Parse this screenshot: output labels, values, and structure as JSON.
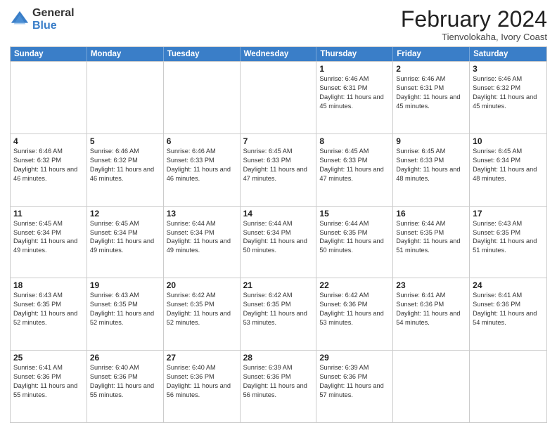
{
  "logo": {
    "general": "General",
    "blue": "Blue"
  },
  "title": "February 2024",
  "subtitle": "Tienvolokaha, Ivory Coast",
  "days": [
    "Sunday",
    "Monday",
    "Tuesday",
    "Wednesday",
    "Thursday",
    "Friday",
    "Saturday"
  ],
  "weeks": [
    [
      {
        "day": "",
        "info": ""
      },
      {
        "day": "",
        "info": ""
      },
      {
        "day": "",
        "info": ""
      },
      {
        "day": "",
        "info": ""
      },
      {
        "day": "1",
        "info": "Sunrise: 6:46 AM\nSunset: 6:31 PM\nDaylight: 11 hours and 45 minutes."
      },
      {
        "day": "2",
        "info": "Sunrise: 6:46 AM\nSunset: 6:31 PM\nDaylight: 11 hours and 45 minutes."
      },
      {
        "day": "3",
        "info": "Sunrise: 6:46 AM\nSunset: 6:32 PM\nDaylight: 11 hours and 45 minutes."
      }
    ],
    [
      {
        "day": "4",
        "info": "Sunrise: 6:46 AM\nSunset: 6:32 PM\nDaylight: 11 hours and 46 minutes."
      },
      {
        "day": "5",
        "info": "Sunrise: 6:46 AM\nSunset: 6:32 PM\nDaylight: 11 hours and 46 minutes."
      },
      {
        "day": "6",
        "info": "Sunrise: 6:46 AM\nSunset: 6:33 PM\nDaylight: 11 hours and 46 minutes."
      },
      {
        "day": "7",
        "info": "Sunrise: 6:45 AM\nSunset: 6:33 PM\nDaylight: 11 hours and 47 minutes."
      },
      {
        "day": "8",
        "info": "Sunrise: 6:45 AM\nSunset: 6:33 PM\nDaylight: 11 hours and 47 minutes."
      },
      {
        "day": "9",
        "info": "Sunrise: 6:45 AM\nSunset: 6:33 PM\nDaylight: 11 hours and 48 minutes."
      },
      {
        "day": "10",
        "info": "Sunrise: 6:45 AM\nSunset: 6:34 PM\nDaylight: 11 hours and 48 minutes."
      }
    ],
    [
      {
        "day": "11",
        "info": "Sunrise: 6:45 AM\nSunset: 6:34 PM\nDaylight: 11 hours and 49 minutes."
      },
      {
        "day": "12",
        "info": "Sunrise: 6:45 AM\nSunset: 6:34 PM\nDaylight: 11 hours and 49 minutes."
      },
      {
        "day": "13",
        "info": "Sunrise: 6:44 AM\nSunset: 6:34 PM\nDaylight: 11 hours and 49 minutes."
      },
      {
        "day": "14",
        "info": "Sunrise: 6:44 AM\nSunset: 6:34 PM\nDaylight: 11 hours and 50 minutes."
      },
      {
        "day": "15",
        "info": "Sunrise: 6:44 AM\nSunset: 6:35 PM\nDaylight: 11 hours and 50 minutes."
      },
      {
        "day": "16",
        "info": "Sunrise: 6:44 AM\nSunset: 6:35 PM\nDaylight: 11 hours and 51 minutes."
      },
      {
        "day": "17",
        "info": "Sunrise: 6:43 AM\nSunset: 6:35 PM\nDaylight: 11 hours and 51 minutes."
      }
    ],
    [
      {
        "day": "18",
        "info": "Sunrise: 6:43 AM\nSunset: 6:35 PM\nDaylight: 11 hours and 52 minutes."
      },
      {
        "day": "19",
        "info": "Sunrise: 6:43 AM\nSunset: 6:35 PM\nDaylight: 11 hours and 52 minutes."
      },
      {
        "day": "20",
        "info": "Sunrise: 6:42 AM\nSunset: 6:35 PM\nDaylight: 11 hours and 52 minutes."
      },
      {
        "day": "21",
        "info": "Sunrise: 6:42 AM\nSunset: 6:35 PM\nDaylight: 11 hours and 53 minutes."
      },
      {
        "day": "22",
        "info": "Sunrise: 6:42 AM\nSunset: 6:36 PM\nDaylight: 11 hours and 53 minutes."
      },
      {
        "day": "23",
        "info": "Sunrise: 6:41 AM\nSunset: 6:36 PM\nDaylight: 11 hours and 54 minutes."
      },
      {
        "day": "24",
        "info": "Sunrise: 6:41 AM\nSunset: 6:36 PM\nDaylight: 11 hours and 54 minutes."
      }
    ],
    [
      {
        "day": "25",
        "info": "Sunrise: 6:41 AM\nSunset: 6:36 PM\nDaylight: 11 hours and 55 minutes."
      },
      {
        "day": "26",
        "info": "Sunrise: 6:40 AM\nSunset: 6:36 PM\nDaylight: 11 hours and 55 minutes."
      },
      {
        "day": "27",
        "info": "Sunrise: 6:40 AM\nSunset: 6:36 PM\nDaylight: 11 hours and 56 minutes."
      },
      {
        "day": "28",
        "info": "Sunrise: 6:39 AM\nSunset: 6:36 PM\nDaylight: 11 hours and 56 minutes."
      },
      {
        "day": "29",
        "info": "Sunrise: 6:39 AM\nSunset: 6:36 PM\nDaylight: 11 hours and 57 minutes."
      },
      {
        "day": "",
        "info": ""
      },
      {
        "day": "",
        "info": ""
      }
    ]
  ]
}
